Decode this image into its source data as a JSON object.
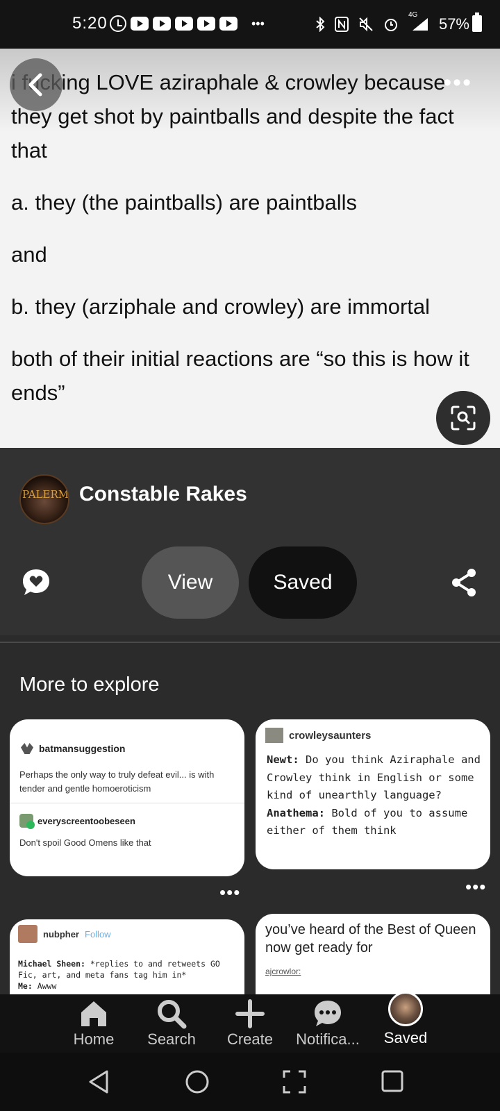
{
  "status_bar": {
    "time": "5:20",
    "network": "4G",
    "battery": "57%",
    "icons": [
      "clock-icon",
      "youtube-icon",
      "bluetooth-icon",
      "nfc-icon",
      "mute-icon",
      "alarm-icon",
      "signal-icon",
      "battery-icon"
    ]
  },
  "post": {
    "paragraphs": [
      "i fucking LOVE aziraphale & crowley because they get shot by paintballs and despite the fact that",
      "a. they (the paintballs) are paintballs",
      "and",
      "b. they (arziphale and crowley) are immortal",
      "both of their initial reactions are “so this is how it ends”"
    ],
    "more_label": "•••"
  },
  "creator": {
    "name": "Constable Rakes",
    "avatar_text": "PALERMO"
  },
  "actions": {
    "view_label": "View",
    "saved_label": "Saved"
  },
  "explore": {
    "title": "More to explore",
    "card_more": "•••",
    "cards": [
      {
        "user1": "batmansuggestion",
        "text1": "Perhaps the only way to truly defeat evil... is with tender and gentle homoeroticism",
        "user2": "everyscreentoobeseen",
        "text2": "Don't spoil Good Omens like that"
      },
      {
        "user": "crowleysaunters",
        "speaker1": "Newt:",
        "line1": " Do you think Aziraphale and Crowley think in English or some kind of unearthly language?",
        "speaker2": "Anathema:",
        "line2": " Bold of you to assume either of them think"
      },
      {
        "user": "nubpher",
        "follow": "Follow",
        "speaker1": "Michael Sheen:",
        "line1": " *replies to and retweets GO Fic, art, and meta fans tag him in*",
        "speaker2": "Me:",
        "line2": " Awww"
      },
      {
        "title": "you’ve heard of the Best of Queen now get ready for",
        "user": "ajcrowlor:"
      }
    ]
  },
  "bottom_nav": {
    "items": [
      "Home",
      "Search",
      "Create",
      "Notifica...",
      "Saved"
    ]
  }
}
